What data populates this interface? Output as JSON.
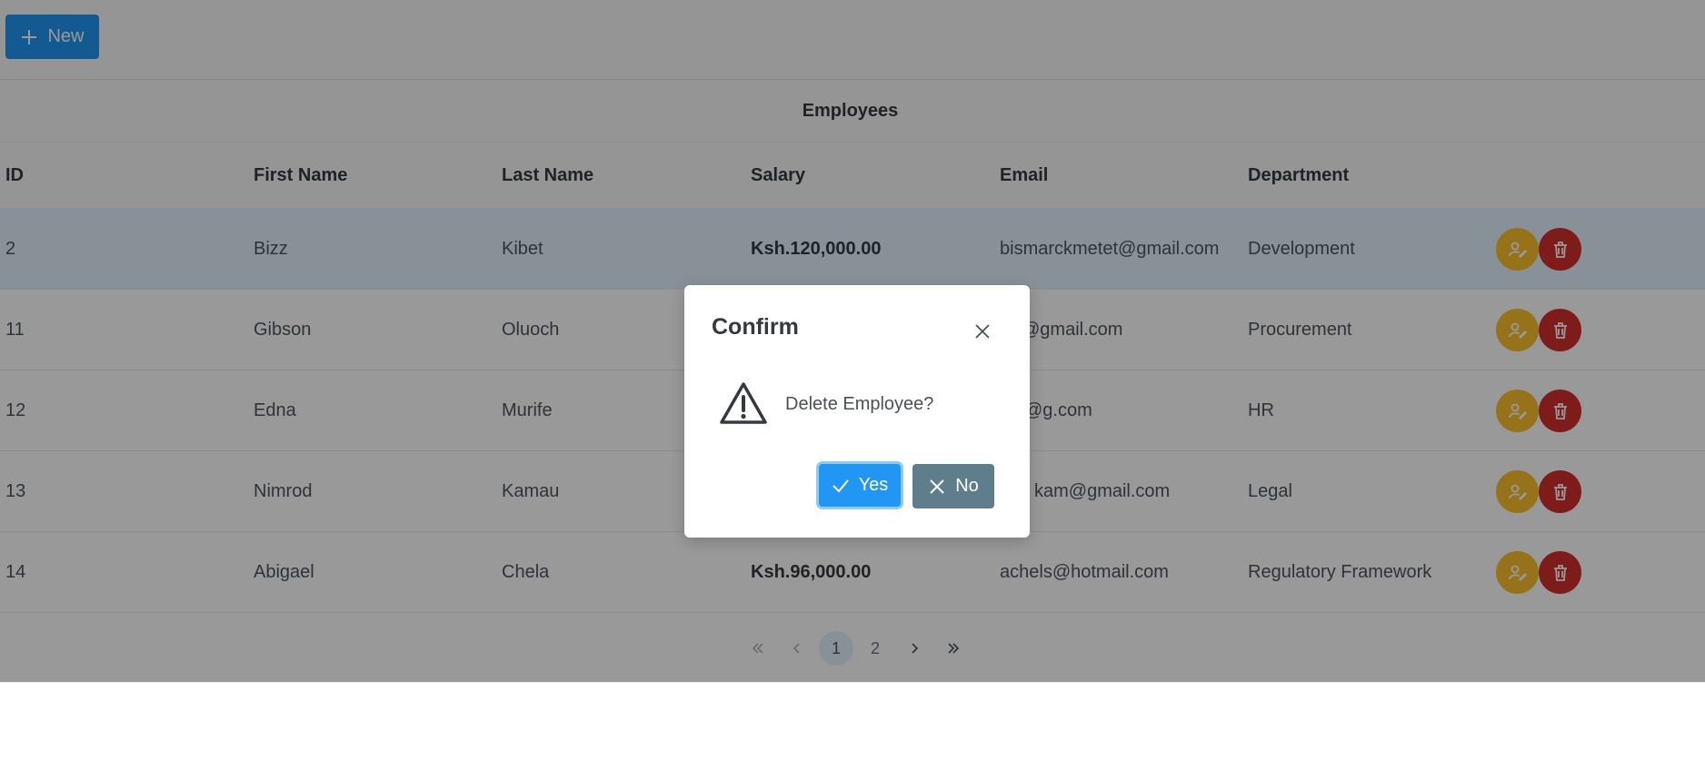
{
  "toolbar": {
    "new_label": "New",
    "new_icon": "plus-icon"
  },
  "table": {
    "title": "Employees",
    "columns": [
      "ID",
      "First Name",
      "Last Name",
      "Salary",
      "Email",
      "Department"
    ],
    "rows": [
      {
        "id": "2",
        "first_name": "Bizz",
        "last_name": "Kibet",
        "salary": "Ksh.120,000.00",
        "email": "bismarckmetet@gmail.com",
        "department": "Development",
        "selected": true
      },
      {
        "id": "11",
        "first_name": "Gibson",
        "last_name": "Oluoch",
        "salary": "",
        "email": "@gmail.com",
        "department": "Procurement",
        "selected": false
      },
      {
        "id": "12",
        "first_name": "Edna",
        "last_name": "Murife",
        "salary": "",
        "email": "@g.com",
        "department": "HR",
        "selected": false
      },
      {
        "id": "13",
        "first_name": "Nimrod",
        "last_name": "Kamau",
        "salary": "",
        "email": "kam@gmail.com",
        "department": "Legal",
        "selected": false
      },
      {
        "id": "14",
        "first_name": "Abigael",
        "last_name": "Chela",
        "salary": "Ksh.96,000.00",
        "email": "achels@hotmail.com",
        "department": "Regulatory Framework",
        "selected": false
      }
    ]
  },
  "paginator": {
    "pages": [
      "1",
      "2"
    ],
    "current_page": "1"
  },
  "dialog": {
    "title": "Confirm",
    "message": "Delete Employee?",
    "yes_label": "Yes",
    "no_label": "No"
  },
  "colors": {
    "primary": "#2196f3",
    "secondary": "#607d8b",
    "edit": "#fbc02d",
    "delete": "#d32f2f",
    "selected_row": "#e3f2fd"
  }
}
